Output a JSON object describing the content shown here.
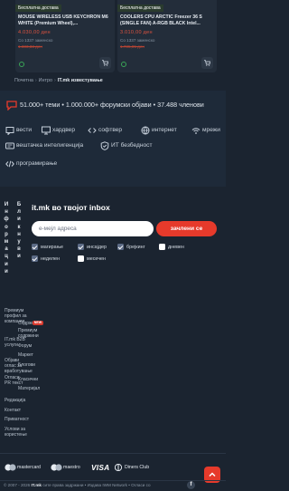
{
  "products": [
    {
      "badge": "Бесплатна достава",
      "title": "MOUSE WIRELESS USB KEYCHRON M6 WHITE (Premium Wheel),...",
      "price": "4.030,00 ден",
      "shipping": "Со 1337 заменско",
      "old_price": "1.333,33 ден"
    },
    {
      "badge": "Бесплатна достава",
      "title": "COOLERS CPU ARCTIC Freezer 36 S (SINGLE FAN) A-RGB BLACK Intel...",
      "price": "3.010,00 ден",
      "shipping": "Со 1337 заменско",
      "old_price": "1.735,05 ден"
    }
  ],
  "breadcrumb": {
    "items": [
      "Почетна",
      "Интро"
    ],
    "current": "IT.mk известување",
    "sep": "›"
  },
  "stats": {
    "text": "51.000+ теми • 1.000.000+ форумски објави • 37.488 членови"
  },
  "features": [
    {
      "icon": "chat-icon",
      "label": "вести"
    },
    {
      "icon": "monitor-icon",
      "label": "хардвер"
    },
    {
      "icon": "code-icon",
      "label": "софтвер"
    },
    {
      "icon": "globe-icon",
      "label": "интернет"
    },
    {
      "icon": "network-icon",
      "label": "мрежи"
    },
    {
      "icon": "ai-chip-icon",
      "label": "вештачка интелигенција"
    },
    {
      "icon": "shield-icon",
      "label": "ИТ безбедност"
    },
    {
      "icon": "code-brackets-icon",
      "label": "програмирање"
    }
  ],
  "newsletter": {
    "vertical_left": "Информации",
    "vertical_right": "Бликнуви",
    "title": "it.mk во твојот inbox",
    "placeholder": "е-мејл адреса",
    "button": "зачлени се",
    "options": [
      {
        "label": "магирање",
        "checked": true
      },
      {
        "label": "инсајдер",
        "checked": true
      },
      {
        "label": "брејкинг",
        "checked": true
      },
      {
        "label": "дневен",
        "checked": false
      },
      {
        "label": "неделен",
        "checked": true
      },
      {
        "label": "месечен",
        "checked": false
      }
    ]
  },
  "footer": {
    "col1": [
      "Премиум профил за компании",
      "IT.mk B2B услуги",
      "Објави оглас за вработување",
      "Огласи",
      "PR текст",
      "Редакција",
      "Контакт",
      "Приватност",
      "Услови за користење"
    ],
    "col2": [
      "Содржини",
      "Премиум содржини",
      "Форум",
      "Маркет",
      "Блогови",
      "Класични",
      "Материјал"
    ],
    "new_badge": "NEW"
  },
  "payments": {
    "mastercard": "mastercard",
    "maestro": "maestro",
    "visa": "VISA",
    "diners": "Diners Club"
  },
  "copyright": {
    "prefix": "© 2007 - 2026",
    "brand": "IT.mk",
    "rest": "сите права задржани • Издава IWM Network • Огласи со"
  },
  "colors": {
    "background": "#1b2430",
    "accent": "#e63a2b",
    "band": "#1e2a39"
  }
}
